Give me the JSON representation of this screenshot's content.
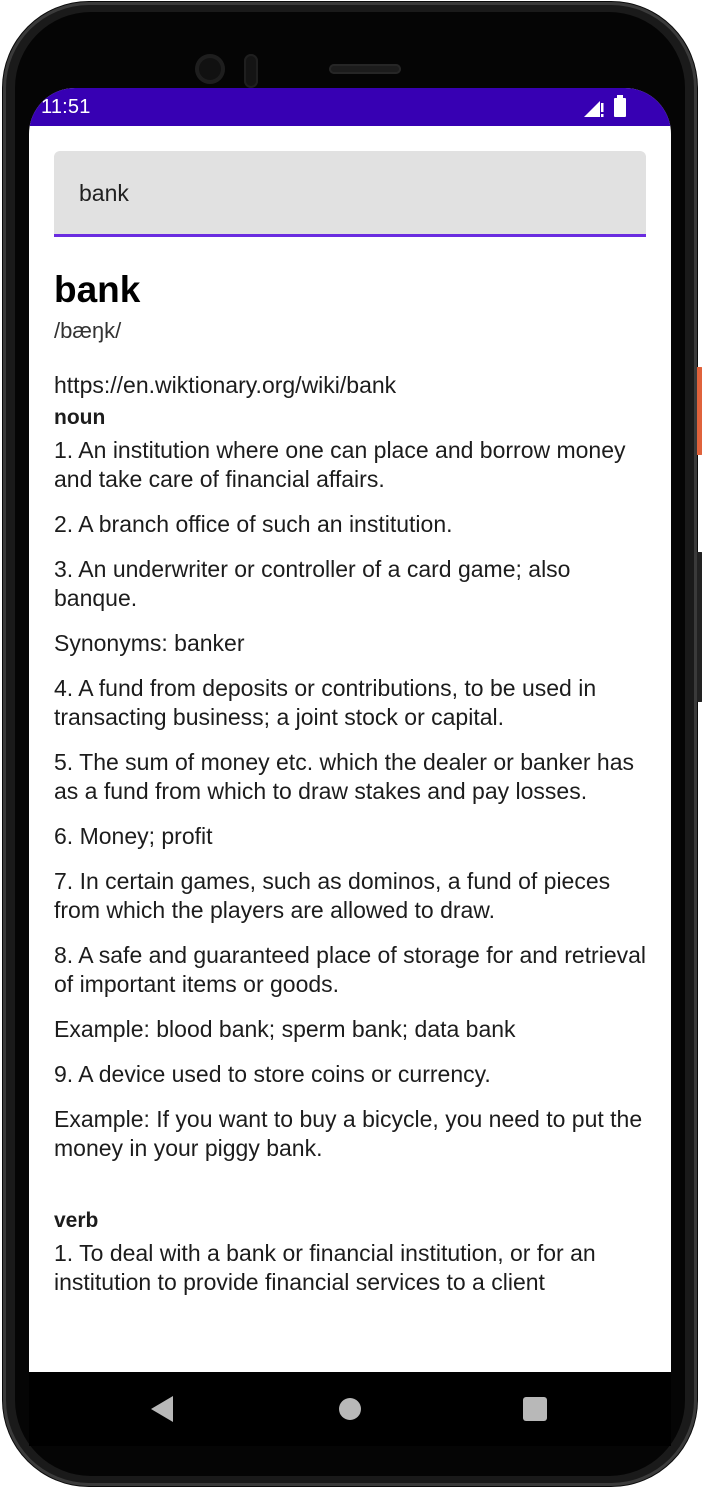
{
  "status_bar": {
    "time": "11:51"
  },
  "search": {
    "value": "bank"
  },
  "entry": {
    "word": "bank",
    "phonetic": "/bæŋk/",
    "source_url": "https://en.wiktionary.org/wiki/bank",
    "noun": {
      "label": "noun",
      "lines": [
        "1. An institution where one can place and borrow money and take care of financial affairs.",
        "2. A branch office of such an institution.",
        "3. An underwriter or controller of a card game; also banque.",
        "Synonyms: banker",
        "4. A fund from deposits or contributions, to be used in transacting business; a joint stock or capital.",
        "5. The sum of money etc. which the dealer or banker has as a fund from which to draw stakes and pay losses.",
        "6. Money; profit",
        "7. In certain games, such as dominos, a fund of pieces from which the players are allowed to draw.",
        "8. A safe and guaranteed place of storage for and retrieval of important items or goods.",
        "Example: blood bank; sperm bank; data bank",
        "9. A device used to store coins or currency.",
        "Example: If you want to buy a bicycle, you need to put the money in your piggy bank."
      ]
    },
    "verb": {
      "label": "verb",
      "lines": [
        "1. To deal with a bank or financial institution, or for an institution to provide financial services to a client"
      ]
    }
  },
  "icons": {
    "signal": "signal-icon",
    "battery": "battery-icon",
    "back": "back-icon",
    "home": "home-icon",
    "recents": "recents-icon"
  },
  "colors": {
    "status_bar": "#3700b3",
    "accent_underline": "#6a2ce0"
  }
}
